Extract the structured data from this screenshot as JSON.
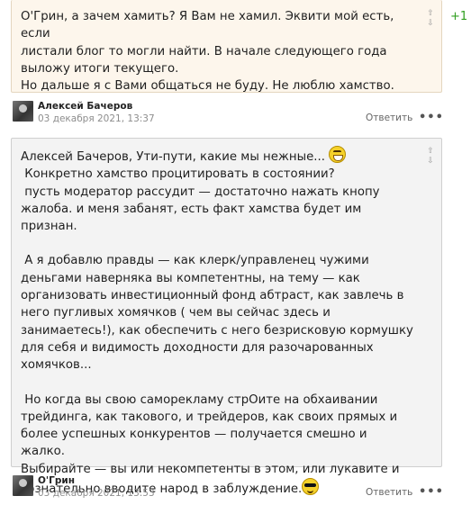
{
  "comments": [
    {
      "lines": [
        "О'Грин, а зачем хамить? Я Вам не хамил. Эквити мой есть, если",
        "листали блог то могли найти. В начале следующего года",
        "выложу итоги текущего.",
        "Но дальше я с Вами общаться не буду. Не люблю хамство."
      ],
      "score": "+1",
      "vote_up": "⇧",
      "vote_down": "⇩"
    },
    {
      "para1": [
        "Алексей Бачеров, Ути-пути, какие мы нежные... ",
        " Конкретно хамство процитировать в состоянии?",
        " пусть модератор рассудит — достаточно нажать кнопу",
        "жалоба. и меня забанят, есть факт хамства будет им признан."
      ],
      "para2": [
        " А я добавлю правды — как клерк/управленец чужими",
        "деньгами наверняка вы компетентны, на тему — как",
        "организовать инвестиционный фонд абтраст, как завлечь в",
        "него пугливых хомячков ( чем вы сейчас здесь и",
        "занимаетесь!), как обеспечить с него безрисковую кормушку",
        "для себя и видимость доходности для разочарованных",
        "хомячков..."
      ],
      "para3": [
        " Но когда вы свою саморекламу стрОите на обхаивании",
        "трейдинга, как такового, и трейдеров, как своих прямых и",
        "более успешных конкурентов — получается смешно и жалко.",
        "Выбирайте — вы или некомпетенты в этом, или лукавите и",
        "сознательно вводите народ в заблуждение."
      ],
      "vote_up": "⇧",
      "vote_down": "⇩"
    }
  ],
  "meta": [
    {
      "author": "Алексей Бачеров",
      "date": "03 декабря 2021, 13:37",
      "reply": "Ответить",
      "more": "•••"
    },
    {
      "author": "О'Грин",
      "date": "03 декабря 2021, 13:53",
      "reply": "Ответить",
      "more": "•••"
    }
  ],
  "emoji": {
    "first": "laughing-smiley-icon",
    "second": "sunglasses-smiley-icon"
  }
}
